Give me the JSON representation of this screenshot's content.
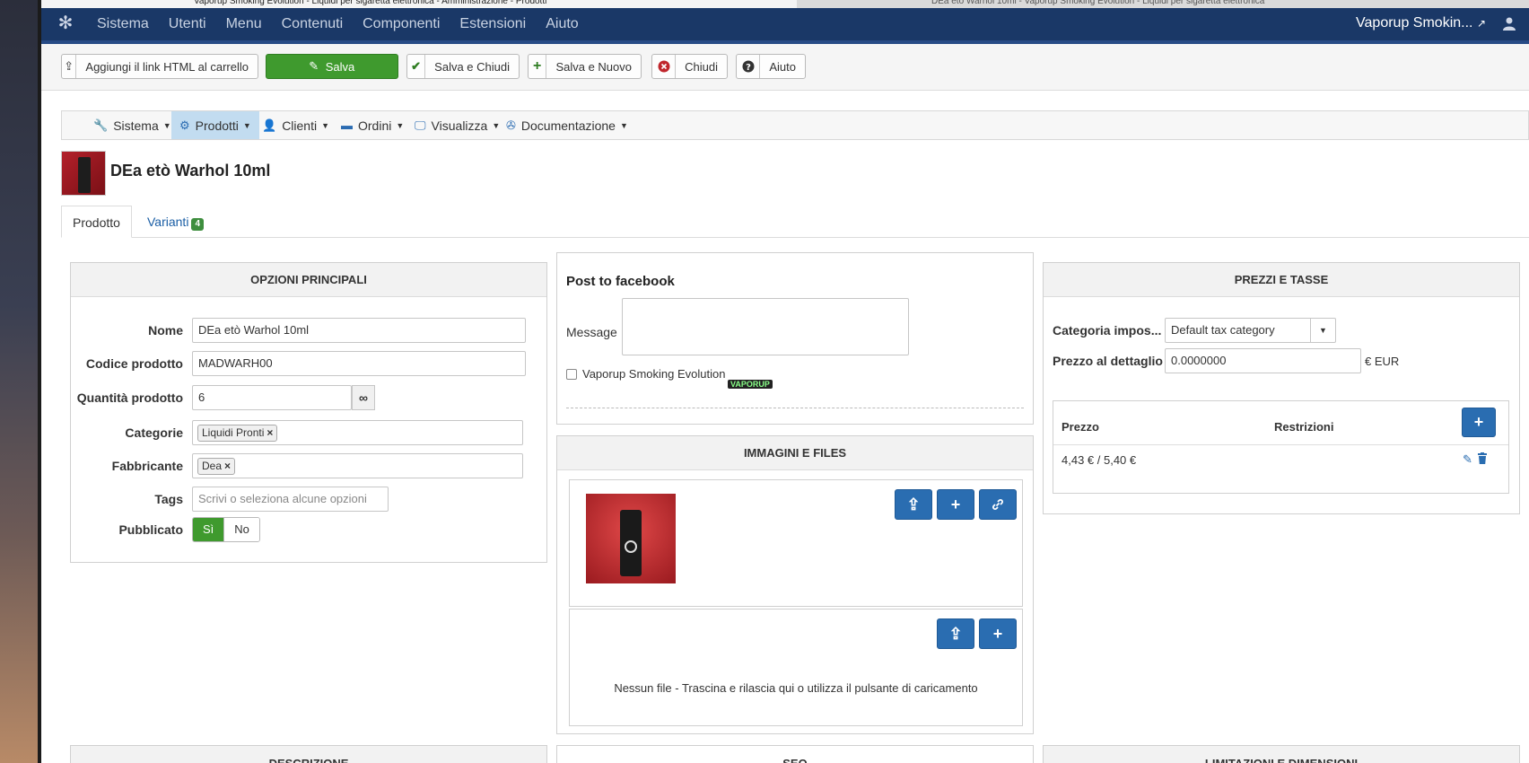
{
  "browser_tabs": [
    "Vaporup Smoking Evolution - Liquidi per sigaretta elettronica - Amministrazione - Prodotti",
    "DEa etò Warhol 10ml - Vaporup Smoking Evolution - Liquidi per sigaretta elettronica"
  ],
  "topnav": {
    "menu": [
      "Sistema",
      "Utenti",
      "Menu",
      "Contenuti",
      "Componenti",
      "Estensioni",
      "Aiuto"
    ],
    "site_name": "Vaporup Smokin...",
    "external_icon": "↗"
  },
  "toolbar": {
    "add_html_link": "Aggiungi il link HTML al carrello",
    "save": "Salva",
    "save_close": "Salva e Chiudi",
    "save_new": "Salva e Nuovo",
    "close": "Chiudi",
    "help": "Aiuto"
  },
  "subnav": [
    {
      "label": "Sistema",
      "icon": "wrench-icon",
      "glyph": "🔧"
    },
    {
      "label": "Prodotti",
      "icon": "cubes-icon",
      "glyph": "⚙"
    },
    {
      "label": "Clienti",
      "icon": "user-icon",
      "glyph": "👤"
    },
    {
      "label": "Ordini",
      "icon": "credit-card-icon",
      "glyph": "▬"
    },
    {
      "label": "Visualizza",
      "icon": "monitor-icon",
      "glyph": "🖵"
    },
    {
      "label": "Documentazione",
      "icon": "lifebuoy-icon",
      "glyph": "✇"
    }
  ],
  "product": {
    "title": "DEa etò Warhol 10ml"
  },
  "tabs": {
    "product": "Prodotto",
    "variants": "Varianti",
    "variants_count": "4"
  },
  "main_options": {
    "heading": "OPZIONI PRINCIPALI",
    "name_label": "Nome",
    "name_value": "DEa etò Warhol 10ml",
    "code_label": "Codice prodotto",
    "code_value": "MADWARH00",
    "qty_label": "Quantità prodotto",
    "qty_value": "6",
    "qty_addon": "∞",
    "categories_label": "Categorie",
    "category_chip": "Liquidi Pronti",
    "manufacturer_label": "Fabbricante",
    "manufacturer_chip": "Dea",
    "tags_label": "Tags",
    "tags_placeholder": "Scrivi o seleziona alcune opzioni",
    "published_label": "Pubblicato",
    "published_yes": "Sì",
    "published_no": "No"
  },
  "facebook": {
    "title": "Post to facebook",
    "message_label": "Message",
    "account_label": "Vaporup Smoking Evolution",
    "logo_text": "VAPORUP"
  },
  "images": {
    "heading": "IMMAGINI E FILES",
    "no_file_text": "Nessun file - Trascina e rilascia qui o utilizza il pulsante di caricamento"
  },
  "prices": {
    "heading": "PREZZI E TASSE",
    "tax_label": "Categoria impos...",
    "tax_value": "Default tax category",
    "retail_label": "Prezzo al dettaglio",
    "retail_value": "0.0000000",
    "currency": "€ EUR",
    "col_price": "Prezzo",
    "col_restrictions": "Restrizioni",
    "row_price": "4,43 € / 5,40 €"
  },
  "bottom_panels": [
    "DESCRIZIONE",
    "SEO",
    "LIMITAZIONI E DIMENSIONI"
  ]
}
